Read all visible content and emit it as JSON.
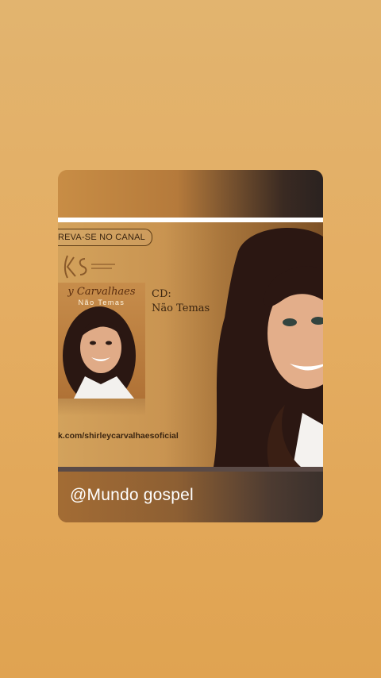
{
  "post": {
    "subscribe_text": "REVA-SE NO CANAL",
    "logo_text": "KS",
    "album_artist": "y Carvalhaes",
    "album_name": "Não Temas",
    "cd_label": "CD:",
    "cd_title": "Não Temas",
    "url_text": "k.com/shirleycarvalhaesoficial",
    "caption": "@Mundo gospel"
  },
  "colors": {
    "background": "#e2ad63",
    "caption_text": "#ffffff",
    "accent_brown": "#5a2d0e"
  }
}
